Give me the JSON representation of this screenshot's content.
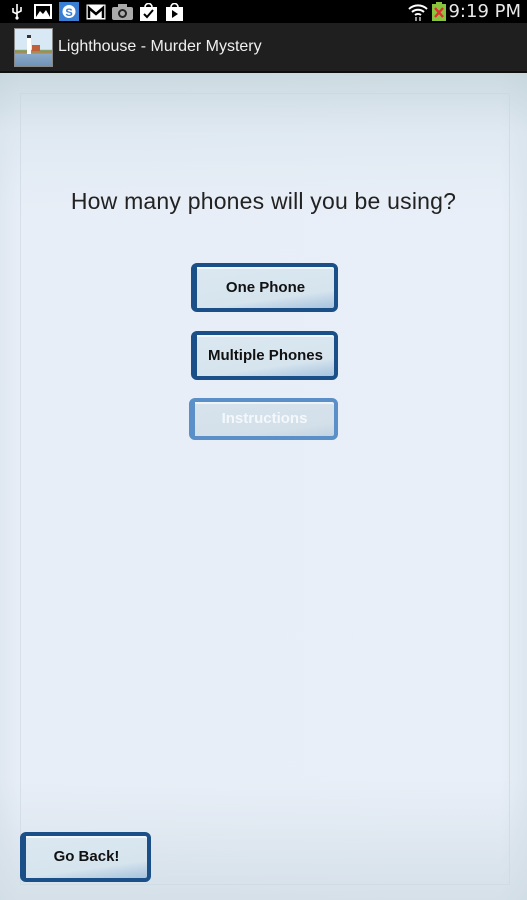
{
  "status_bar": {
    "left_icons": [
      "usb-icon",
      "gallery-icon",
      "skype-icon",
      "gmail-icon",
      "camera-icon",
      "store-download-icon",
      "play-store-icon"
    ],
    "right_icons": [
      "wifi-icon",
      "battery-charging-error-icon"
    ],
    "time": "9:19 PM"
  },
  "action_bar": {
    "app_icon": "lighthouse-app-icon",
    "title": "Lighthouse - Murder Mystery"
  },
  "main": {
    "question": "How many phones will you be using?",
    "buttons": {
      "one_phone": "One Phone",
      "multiple_phones": "Multiple Phones",
      "instructions": "Instructions"
    },
    "instructions_state": "disabled",
    "go_back": "Go Back!"
  },
  "colors": {
    "button_border": "#1a4f88",
    "button_border_disabled": "#5b8fc8",
    "button_fill": "#d6e4ee",
    "status_bar_bg": "#000000",
    "action_bar_bg": "#1f1f1f"
  }
}
